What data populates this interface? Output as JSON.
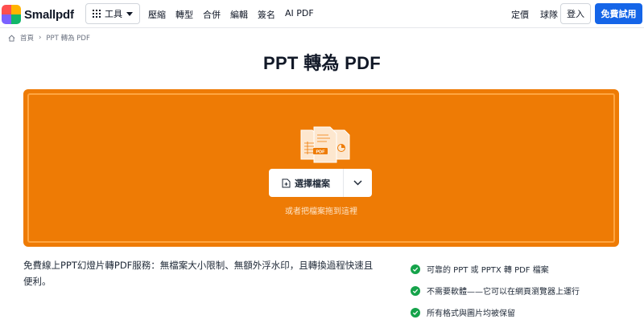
{
  "brand": {
    "name": "Smallpdf"
  },
  "nav": {
    "tools_label": "工具",
    "links": [
      "壓縮",
      "轉型",
      "合併",
      "編輯",
      "簽名",
      "AI PDF"
    ],
    "pricing": "定價",
    "teams": "球隊",
    "login": "登入",
    "trial": "免費試用"
  },
  "breadcrumb": {
    "home": "首頁",
    "current": "PPT 轉為 PDF"
  },
  "page": {
    "title": "PPT 轉為 PDF"
  },
  "dropzone": {
    "choose_label": "選擇檔案",
    "hint": "或者把檔案拖到這裡",
    "illustration_badge": "PDF"
  },
  "description": "免費線上PPT幻燈片轉PDF服務：無檔案大小限制、無額外浮水印，且轉換過程快速且便利。",
  "features": [
    "可靠的 PPT 或 PPTX 轉 PDF 檔案",
    "不需要軟體——它可以在網頁瀏覽器上運行",
    "所有格式與圖片均被保留"
  ],
  "colors": {
    "accent_orange": "#ee7b05",
    "primary_blue": "#1565e8",
    "check_green": "#15a34a"
  }
}
